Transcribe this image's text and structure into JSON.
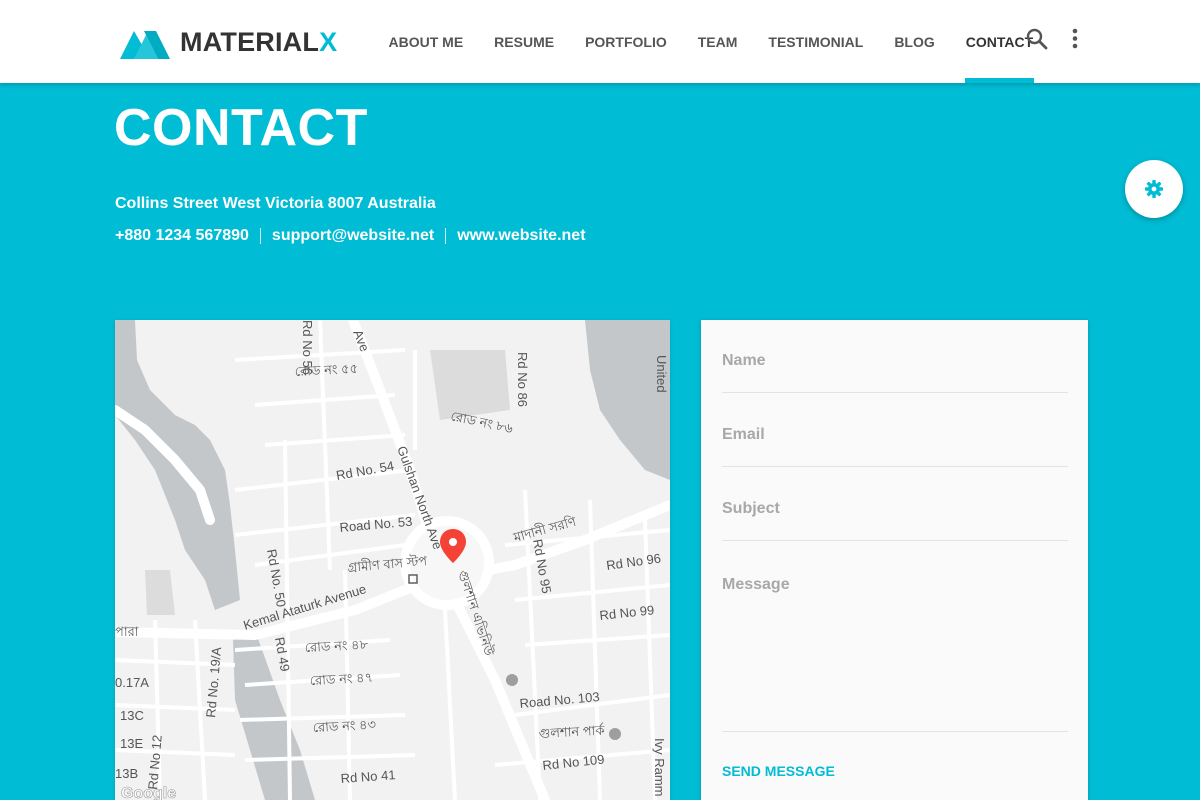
{
  "brand": {
    "name_main": "MATERIAL",
    "name_accent": "X",
    "accent_color": "#00bcd4",
    "logo_icon": "materialx-logo-icon"
  },
  "nav": {
    "items": [
      {
        "label": "ABOUT ME"
      },
      {
        "label": "RESUME"
      },
      {
        "label": "PORTFOLIO"
      },
      {
        "label": "TEAM"
      },
      {
        "label": "TESTIMONIAL"
      },
      {
        "label": "BLOG"
      },
      {
        "label": "CONTACT",
        "active": true
      }
    ],
    "search_icon": "search-icon",
    "more_icon": "more-vertical-icon"
  },
  "hero": {
    "title": "CONTACT",
    "address": "Collins Street West Victoria 8007 Australia",
    "phone": "+880 1234 567890",
    "email": "support@website.net",
    "website": "www.website.net",
    "background_color": "#00bcd4"
  },
  "settings": {
    "icon": "gear-icon"
  },
  "map": {
    "labels": {
      "gulshan_north": "Gulshan North Ave",
      "kemal_ataturk": "Kemal Ataturk Avenue",
      "ave_top": "Ave",
      "rd54": "Rd No. 54",
      "rd53": "Road No. 53",
      "rd96": "Rd No 96",
      "rd99": "Rd No 99",
      "rd103": "Road No. 103",
      "rd109": "Rd No 109",
      "rd41": "Rd No 41",
      "rd50": "Rd No. 50",
      "rd49": "Rd 49",
      "rd95": "Rd No 95",
      "rd86": "Rd No 86",
      "rd56": "Rd No 56",
      "rd19a": "Rd No. 19/A",
      "rd12": "Rd No 12",
      "n17a": "0.17A",
      "n13c": "13C",
      "n13e": "13E",
      "n13b": "13B",
      "united": "United",
      "ivy": "Ivy Ramm",
      "bn_rd55": "রোড নং ৫৫",
      "bn_rd86": "রোড নং ৮৬",
      "bn_rd48": "রোড নং ৪৮",
      "bn_rd47": "রোড নং ৪৭",
      "bn_rd43": "রোড নং ৪৩",
      "bn_bus": "গ্রামীণ বাস স্টপ",
      "bn_sarani": "মাদানী সরণি",
      "bn_park": "গুলশান পার্ক",
      "bn_gulshan_ave": "গুলশান এভিনিউ",
      "bn_para": "পারা",
      "google": "Google"
    },
    "pin_color": "#f44336"
  },
  "form": {
    "name_placeholder": "Name",
    "email_placeholder": "Email",
    "subject_placeholder": "Subject",
    "message_placeholder": "Message",
    "send_label": "SEND MESSAGE"
  }
}
